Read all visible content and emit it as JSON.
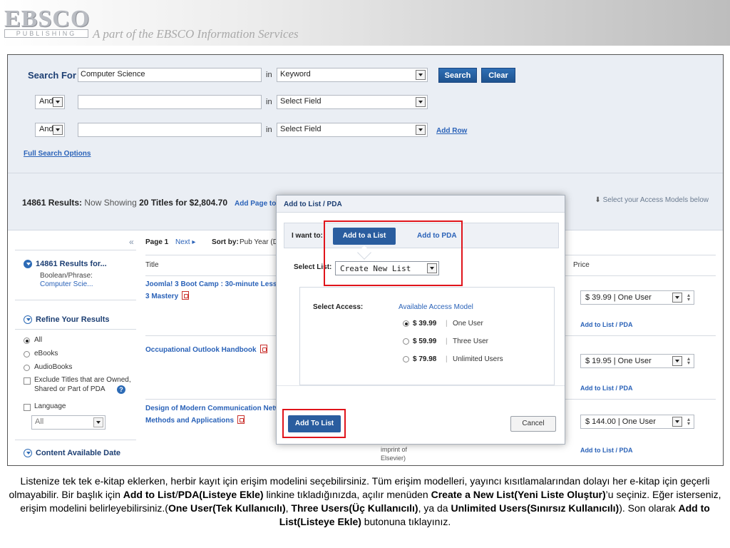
{
  "header": {
    "logo_main": "EBSCO",
    "logo_sub": "PUBLISHING",
    "tagline": "A part of the EBSCO Information Services"
  },
  "search": {
    "label": "Search For",
    "row1_value": "Computer Science",
    "in_label": "in",
    "row1_field": "Keyword",
    "bool2": "And",
    "row2_field": "Select Field",
    "bool3": "And",
    "row3_field": "Select Field",
    "search_btn": "Search",
    "clear_btn": "Clear",
    "add_row": "Add Row",
    "full_options": "Full Search Options"
  },
  "results": {
    "count_bold": "14861 Results:",
    "showing_prefix": "Now Showing",
    "showing_num": "20",
    "titles_for": "Titles for",
    "total": "$2,804.70",
    "add_page": "Add Page to Lis",
    "access_hint": "Select your Access Models below"
  },
  "sidebar": {
    "collapse": "«",
    "results_for": "14861 Results for...",
    "boolean_label": "Boolean/Phrase:",
    "boolean_value": "Computer Scie...",
    "refine": "Refine Your Results",
    "opt_all": "All",
    "opt_ebooks": "eBooks",
    "opt_audiobooks": "AudioBooks",
    "exclude_line1": "Exclude Titles that are Owned,",
    "exclude_line2": "Shared or Part of PDA",
    "language": "Language",
    "lang_value": "All",
    "content_date": "Content Available Date"
  },
  "list": {
    "page": "Page 1",
    "next": "Next ▸",
    "sort_label": "Sort by:",
    "sort_value": "Pub Year (D",
    "col_title": "Title",
    "col_price": "Price",
    "rows": [
      {
        "title_l1": "Joomla! 3 Boot Camp : 30-minute Lesson",
        "title_l2": "3 Mastery",
        "price": "$ 39.99 | One User",
        "add": "Add to List / PDA"
      },
      {
        "title_l1": "Occupational Outlook Handbook",
        "title_l2": "",
        "price": "$ 19.95 | One User",
        "add": "Add to List / PDA"
      },
      {
        "title_l1": "Design of Modern Communication Netwo",
        "title_l2": "Methods and Applications",
        "price": "$ 144.00 | One User",
        "add": "Add to List / PDA"
      }
    ],
    "publisher_l1": "imprint of",
    "publisher_l2": "Elsevier)"
  },
  "modal": {
    "title": "Add to List / PDA",
    "i_want": "I want to:",
    "tab_list": "Add to a List",
    "tab_pda": "Add to PDA",
    "select_list": "Select List:",
    "list_value": "Create New List",
    "select_access": "Select Access:",
    "model_label": "Available Access Model",
    "options": [
      {
        "price": "$ 39.99",
        "model": "One User",
        "selected": true
      },
      {
        "price": "$ 59.99",
        "model": "Three User",
        "selected": false
      },
      {
        "price": "$ 79.98",
        "model": "Unlimited Users",
        "selected": false
      }
    ],
    "add_btn": "Add To List",
    "cancel_btn": "Cancel"
  },
  "caption": {
    "t1": "Listenize tek tek e-kitap eklerken, herbir kayıt için erişim modelini seçebilirsiniz. Tüm erişim modelleri, yayıncı kısıtlamalarından dolayı her e-kitap için geçerli olmayabilir. Bir başlık için ",
    "b1": "Add to List",
    "t2": "/",
    "b2": "PDA(Listeye Ekle)",
    "t3": " linkine tıkladığınızda, açılır menüden ",
    "b3": "Create a New List(Yeni Liste Oluştur)",
    "t4": "’u seçiniz. Eğer isterseniz, erişim modelini belirleyebilirsiniz.(",
    "b4": "One User(Tek Kullanıcılı)",
    "t5": ", ",
    "b5": "Three Users(Üç Kullanıcılı)",
    "t6": ", ya da  ",
    "b6": "Unlimited Users(Sınırsız Kullanıcılı)",
    "t7": "). Son olarak ",
    "b7": "Add to List(Listeye Ekle)",
    "t8": " butonuna tıklayınız."
  },
  "colors": {
    "accent_blue": "#2a5d9f",
    "link_blue": "#2a62b8",
    "highlight_red": "#e0141b",
    "panel_bg": "#eaeef4"
  }
}
